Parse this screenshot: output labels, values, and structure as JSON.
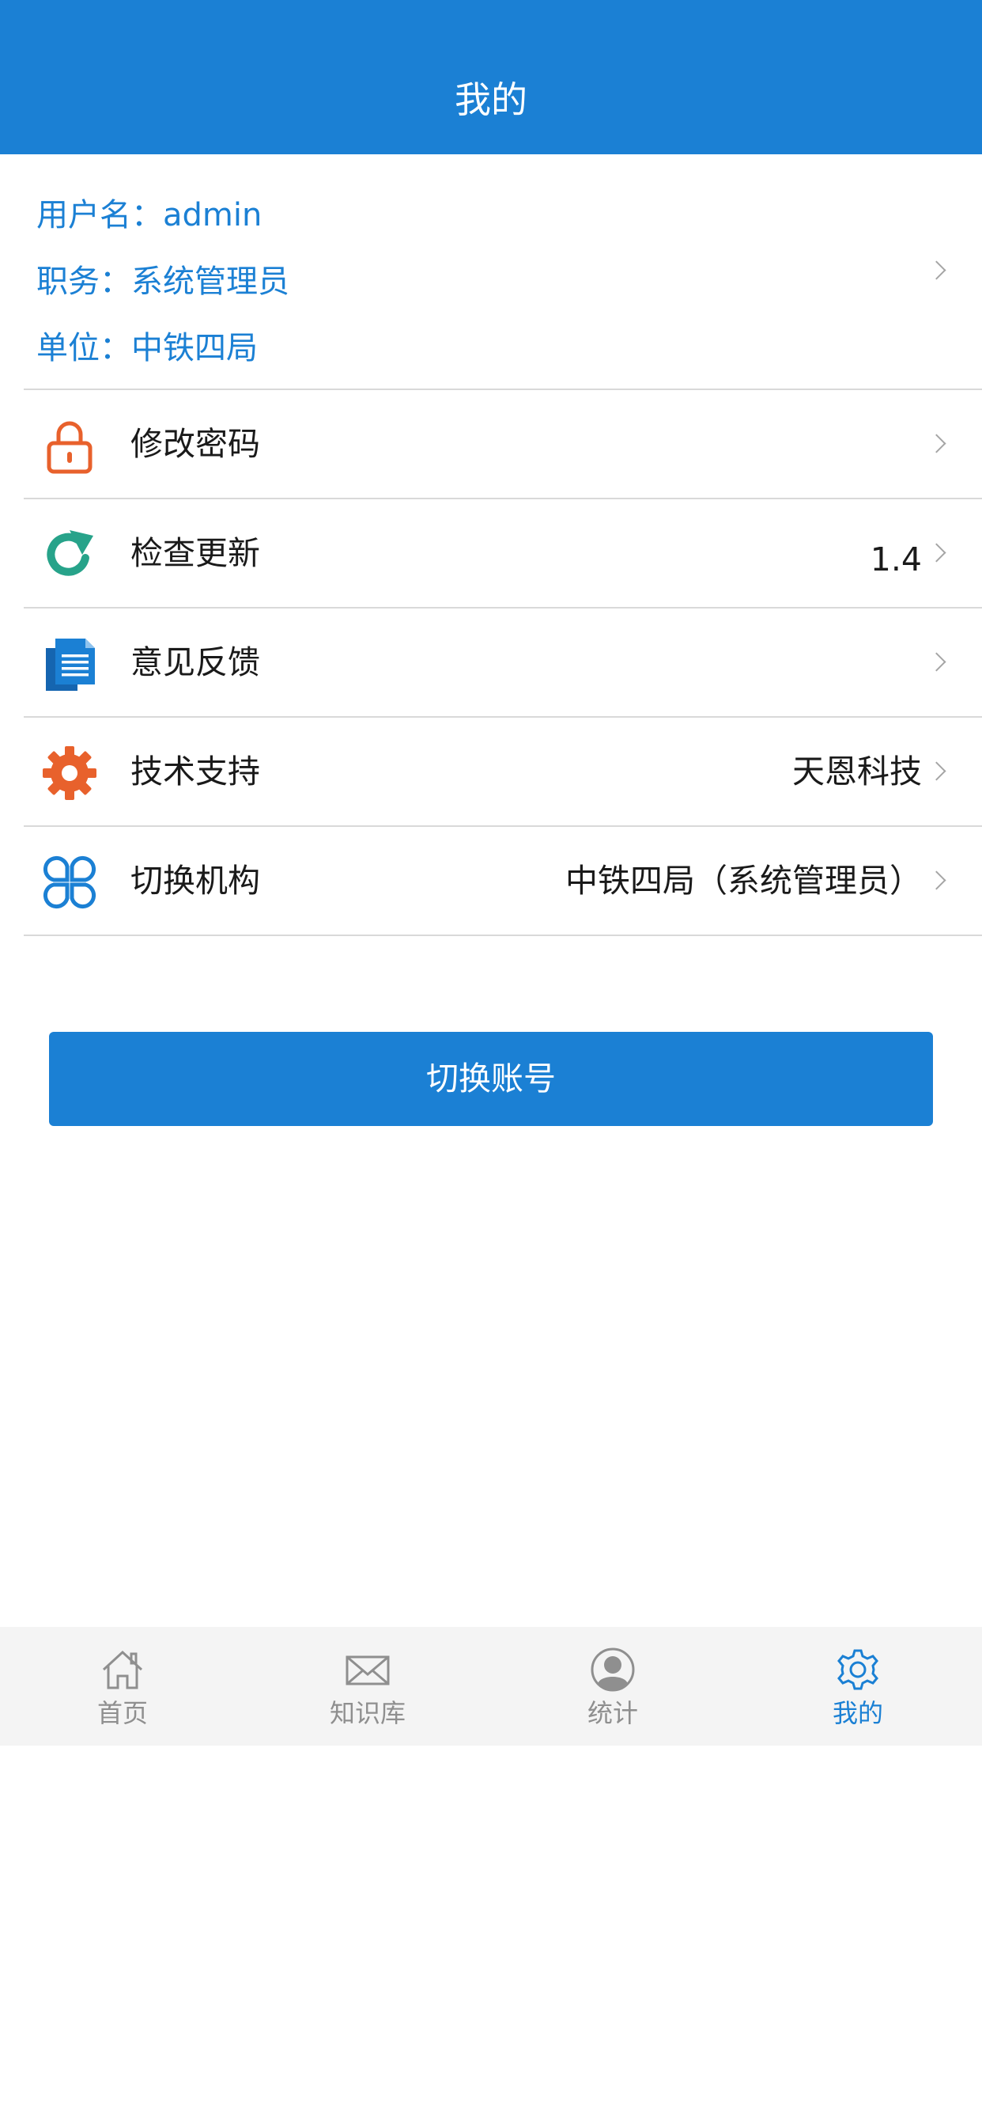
{
  "header": {
    "title": "我的"
  },
  "profile": {
    "username": "用户名：admin",
    "position": "职务：系统管理员",
    "unit": "单位：中铁四局"
  },
  "menu": [
    {
      "icon": "lock-icon",
      "label": "修改密码",
      "value": ""
    },
    {
      "icon": "refresh-icon",
      "label": "检查更新",
      "value": "1.4"
    },
    {
      "icon": "document-icon",
      "label": "意见反馈",
      "value": ""
    },
    {
      "icon": "gear-icon",
      "label": "技术支持",
      "value": "天恩科技"
    },
    {
      "icon": "grid-icon",
      "label": "切换机构",
      "value": "中铁四局（系统管理员）"
    }
  ],
  "button": {
    "label": "切换账号"
  },
  "tabs": [
    {
      "icon": "home-icon",
      "label": "首页",
      "active": false
    },
    {
      "icon": "mail-icon",
      "label": "知识库",
      "active": false
    },
    {
      "icon": "user-icon",
      "label": "统计",
      "active": false
    },
    {
      "icon": "gear-icon",
      "label": "我的",
      "active": true
    }
  ],
  "colors": {
    "primary": "#1b80d4",
    "lock_icon": "#e8612c",
    "refresh_icon": "#27a38a",
    "document_icon": "#1b80d4",
    "gear_icon": "#e8612c",
    "grid_icon": "#1b80d4",
    "tab_inactive": "#8f8f8f",
    "tab_bar_bg": "#f4f4f4",
    "divider": "#d9d9d9"
  }
}
